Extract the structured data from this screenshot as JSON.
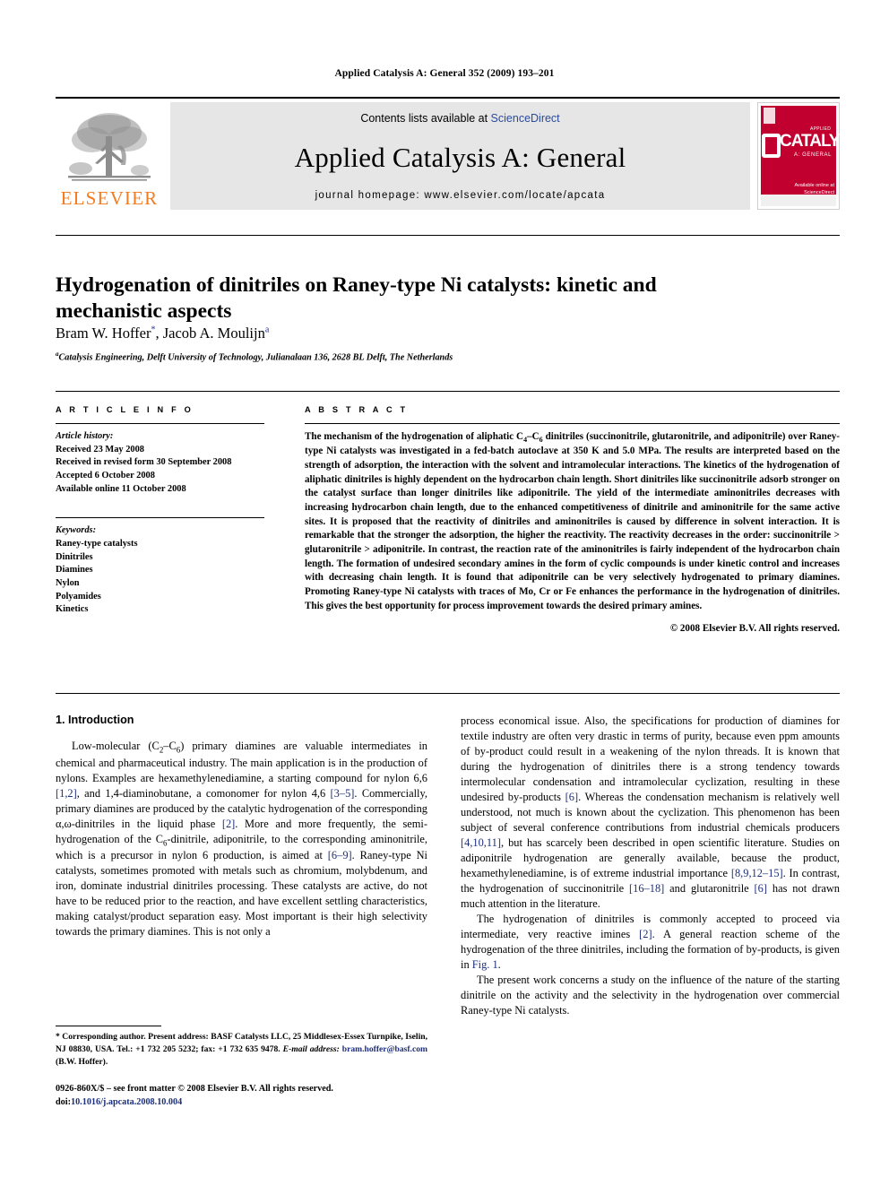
{
  "running_head": "Applied Catalysis A: General 352 (2009) 193–201",
  "masthead": {
    "publisher_name": "ELSEVIER",
    "contents_prefix": "Contents lists available at ",
    "contents_link": "ScienceDirect",
    "journal_title": "Applied Catalysis A: General",
    "homepage": "journal homepage: www.elsevier.com/locate/apcata",
    "cover": {
      "main_word": "CATALYSIS",
      "sub_word": "A: GENERAL",
      "corner_label": "APPLIED",
      "sciencedirect_label": "Available online at",
      "sciencedirect_name": "ScienceDirect"
    }
  },
  "article": {
    "title": "Hydrogenation of dinitriles on Raney-type Ni catalysts: kinetic and mechanistic aspects",
    "authors": "Bram W. Hoffer *, Jacob A. Moulijn a",
    "author_1": "Bram W. Hoffer",
    "author_1_mark": "*",
    "author_sep": ", ",
    "author_2": "Jacob A. Moulijn",
    "author_2_mark": "a",
    "affiliation_mark": "a",
    "affiliation": "Catalysis Engineering, Delft University of Technology, Julianalaan 136, 2628 BL Delft, The Netherlands"
  },
  "article_info": {
    "heading": "A R T I C L E  I N F O",
    "history_label": "Article history:",
    "history": [
      "Received 23 May 2008",
      "Received in revised form 30 September 2008",
      "Accepted 6 October 2008",
      "Available online 11 October 2008"
    ],
    "keywords_label": "Keywords:",
    "keywords": [
      "Raney-type catalysts",
      "Dinitriles",
      "Diamines",
      "Nylon",
      "Polyamides",
      "Kinetics"
    ]
  },
  "abstract": {
    "heading": "A B S T R A C T",
    "body_part1": "The mechanism of the hydrogenation of aliphatic C",
    "sub1": "4",
    "body_part2": "–C",
    "sub2": "6",
    "body_part3": " dinitriles (succinonitrile, glutaronitrile, and adiponitrile) over Raney-type Ni catalysts was investigated in a fed-batch autoclave at 350 K and 5.0 MPa. The results are interpreted based on the strength of adsorption, the interaction with the solvent and intramolecular interactions. The kinetics of the hydrogenation of aliphatic dinitriles is highly dependent on the hydrocarbon chain length. Short dinitriles like succinonitrile adsorb stronger on the catalyst surface than longer dinitriles like adiponitrile. The yield of the intermediate aminonitriles decreases with increasing hydrocarbon chain length, due to the enhanced competitiveness of dinitrile and aminonitrile for the same active sites. It is proposed that the reactivity of dinitriles and aminonitriles is caused by difference in solvent interaction. It is remarkable that the stronger the adsorption, the higher the reactivity. The reactivity decreases in the order: succinonitrile > glutaronitrile > adiponitrile. In contrast, the reaction rate of the aminonitriles is fairly independent of the hydrocarbon chain length. The formation of undesired secondary amines in the form of cyclic compounds is under kinetic control and increases with decreasing chain length. It is found that adiponitrile can be very selectively hydrogenated to primary diamines. Promoting Raney-type Ni catalysts with traces of Mo, Cr or Fe enhances the performance in the hydrogenation of dinitriles. This gives the best opportunity for process improvement towards the desired primary amines.",
    "copyright": "© 2008 Elsevier B.V. All rights reserved."
  },
  "introduction": {
    "heading": "1. Introduction",
    "left_p1_a": "Low-molecular (C",
    "left_p1_sub1": "2",
    "left_p1_b": "–C",
    "left_p1_sub2": "6",
    "left_p1_c": ") primary diamines are valuable intermediates in chemical and pharmaceutical industry. The main application is in the production of nylons. Examples are hexamethylenediamine, a starting compound for nylon 6,6 ",
    "ref_12": "[1,2]",
    "left_p1_d": ", and 1,4-diaminobutane, a comonomer for nylon 4,6 ",
    "ref_35": "[3–5]",
    "left_p1_e": ". Commercially, primary diamines are produced by the catalytic hydrogenation of the corresponding α,ω-dinitriles in the liquid phase ",
    "ref_2": "[2]",
    "left_p1_f": ". More and more frequently, the semi-hydrogenation of the C",
    "left_p1_sub3": "6",
    "left_p1_g": "-dinitrile, adiponitrile, to the corresponding aminonitrile, which is a precursor in nylon 6 production, is aimed at ",
    "ref_69": "[6–9]",
    "left_p1_h": ". Raney-type Ni catalysts, sometimes promoted with metals such as chromium, molybdenum, and iron, dominate industrial dinitriles processing. These catalysts are active, do not have to be reduced prior to the reaction, and have excellent settling characteristics, making catalyst/product separation easy. Most important is their high selectivity towards the primary diamines. This is not only a ",
    "right_p1_a": "process economical issue. Also, the specifications for production of diamines for textile industry are often very drastic in terms of purity, because even ppm amounts of by-product could result in a weakening of the nylon threads. It is known that during the hydrogenation of dinitriles there is a strong tendency towards intermolecular condensation and intramolecular cyclization, resulting in these undesired by-products ",
    "ref_6": "[6]",
    "right_p1_b": ". Whereas the condensation mechanism is relatively well understood, not much is known about the cyclization. This phenomenon has been subject of several conference contributions from industrial chemicals producers ",
    "ref_41011": "[4,10,11]",
    "right_p1_c": ", but has scarcely been described in open scientific literature. Studies on adiponitrile hydrogenation are generally available, because the product, hexamethylenediamine, is of extreme industrial importance ",
    "ref_891215": "[8,9,12–15]",
    "right_p1_d": ". In contrast, the hydrogenation of succinonitrile ",
    "ref_1618": "[16–18]",
    "right_p1_e": " and glutaronitrile ",
    "ref_6b": "[6]",
    "right_p1_f": " has not drawn much attention in the literature.",
    "right_p2_a": "The hydrogenation of dinitriles is commonly accepted to proceed via intermediate, very reactive imines ",
    "ref_2b": "[2]",
    "right_p2_b": ". A general reaction scheme of the hydrogenation of the three dinitriles, including the formation of by-products, is given in ",
    "fig_ref": "Fig. 1",
    "right_p2_c": ".",
    "right_p3": "The present work concerns a study on the influence of the nature of the starting dinitrile on the activity and the selectivity in the hydrogenation over commercial Raney-type Ni catalysts."
  },
  "footnote": {
    "marker": "*",
    "text_a": " Corresponding author. Present address: BASF Catalysts LLC, 25 Middlesex-Essex Turnpike, Iselin, NJ 08830, USA. Tel.: +1 732 205 5232; fax: +1 732 635 9478.",
    "email_label": "E-mail address:",
    "email": "bram.hoffer@basf.com",
    "email_suffix": " (B.W. Hoffer)."
  },
  "footer": {
    "issn_line": "0926-860X/$ – see front matter © 2008 Elsevier B.V. All rights reserved.",
    "doi_label": "doi:",
    "doi": "10.1016/j.apcata.2008.10.004"
  },
  "colors": {
    "link_blue": "#1d2f7a",
    "sciencedirect_blue": "#2a4b9b",
    "elsevier_orange": "#F47B20",
    "cover_red": "#c2002f",
    "band_grey": "#e6e6e6"
  }
}
